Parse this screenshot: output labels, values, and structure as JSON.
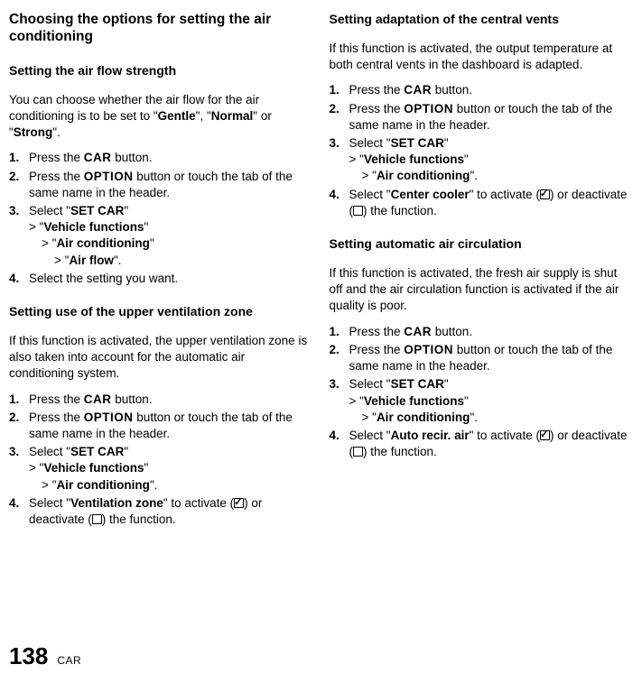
{
  "left": {
    "title": "Choosing the options for setting the air conditioning",
    "sec1": {
      "heading": "Setting the air flow strength",
      "intro_a": "You can choose whether the air flow for the air conditioning is to be set to \"",
      "opt1": "Gentle",
      "sep1": "\", \"",
      "opt2": "Normal",
      "sep2": "\" or \"",
      "opt3": "Strong",
      "intro_b": "\".",
      "s1a": "Press the ",
      "s1b": "CAR",
      "s1c": " button.",
      "s2a": "Press the ",
      "s2b": "OPTION",
      "s2c": " button or touch the tab of the same name in the header.",
      "s3a": "Select \"",
      "s3b": "SET CAR",
      "s3c": "\"",
      "s3n1a": "\"",
      "s3n1b": "Vehicle functions",
      "s3n1c": "\"",
      "s3n2a": "\"",
      "s3n2b": "Air conditioning",
      "s3n2c": "\"",
      "s3n3a": "\"",
      "s3n3b": "Air flow",
      "s3n3c": "\".",
      "s4": "Select the setting you want."
    },
    "sec2": {
      "heading": "Setting use of the upper ventilation zone",
      "intro": "If this function is activated, the upper ventilation zone is also taken into account for the automatic air conditioning system.",
      "s1a": "Press the ",
      "s1b": "CAR",
      "s1c": " button.",
      "s2a": "Press the ",
      "s2b": "OPTION",
      "s2c": " button or touch the tab of the same name in the header.",
      "s3a": "Select \"",
      "s3b": "SET CAR",
      "s3c": "\"",
      "s3n1a": "\"",
      "s3n1b": "Vehicle functions",
      "s3n1c": "\"",
      "s3n2a": "\"",
      "s3n2b": "Air conditioning",
      "s3n2c": "\".",
      "s4a": "Select \"",
      "s4b": "Ventilation zone",
      "s4c": "\" to activate (",
      "s4d": ") or deactivate (",
      "s4e": ") the function."
    }
  },
  "right": {
    "sec1": {
      "heading": "Setting adaptation of the central vents",
      "intro": "If this function is activated, the output temperature at both central vents in the dashboard is adapted.",
      "s1a": "Press the ",
      "s1b": "CAR",
      "s1c": " button.",
      "s2a": "Press the ",
      "s2b": "OPTION",
      "s2c": " button or touch the tab of the same name in the header.",
      "s3a": "Select \"",
      "s3b": "SET CAR",
      "s3c": "\"",
      "s3n1a": "\"",
      "s3n1b": "Vehicle functions",
      "s3n1c": "\"",
      "s3n2a": "\"",
      "s3n2b": "Air conditioning",
      "s3n2c": "\".",
      "s4a": "Select \"",
      "s4b": "Center cooler",
      "s4c": "\" to activate (",
      "s4d": ") or deactivate (",
      "s4e": ") the function."
    },
    "sec2": {
      "heading": "Setting automatic air circulation",
      "intro": "If this function is activated, the fresh air supply is shut off and the air circulation function is activated if the air quality is poor.",
      "s1a": "Press the ",
      "s1b": "CAR",
      "s1c": " button.",
      "s2a": "Press the ",
      "s2b": "OPTION",
      "s2c": " button or touch the tab of the same name in the header.",
      "s3a": "Select \"",
      "s3b": "SET CAR",
      "s3c": "\"",
      "s3n1a": "\"",
      "s3n1b": "Vehicle functions",
      "s3n1c": "\"",
      "s3n2a": "\"",
      "s3n2b": "Air conditioning",
      "s3n2c": "\".",
      "s4a": "Select \"",
      "s4b": "Auto recir. air",
      "s4c": "\" to activate (",
      "s4d": ") or deactivate (",
      "s4e": ") the function."
    }
  },
  "footer": {
    "page": "138",
    "label": "CAR"
  }
}
